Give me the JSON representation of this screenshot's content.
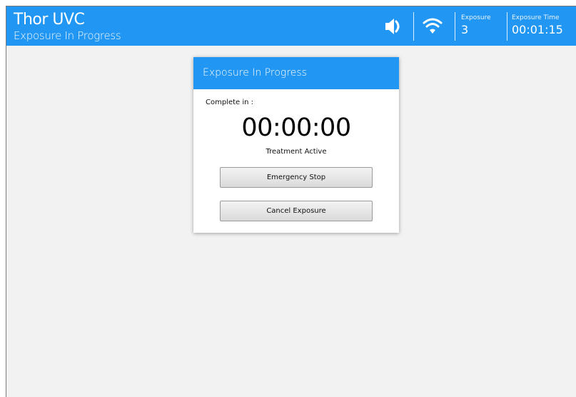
{
  "header": {
    "title": "Thor UVC",
    "subtitle": "Exposure In Progress",
    "sound_icon": "speaker-icon",
    "wifi_icon": "wifi-icon",
    "exposure_label": "Exposure",
    "exposure_value": "3",
    "exposure_time_label": "Exposure Time",
    "exposure_time_value": "00:01:15"
  },
  "dialog": {
    "title": "Exposure In Progress",
    "complete_label": "Complete in :",
    "countdown": "00:00:00",
    "status": "Treatment Active",
    "emergency_stop_label": "Emergency Stop",
    "cancel_exposure_label": "Cancel Exposure"
  },
  "colors": {
    "accent": "#2196f3",
    "background": "#f2f2f2",
    "button": "#e6e6e6"
  }
}
